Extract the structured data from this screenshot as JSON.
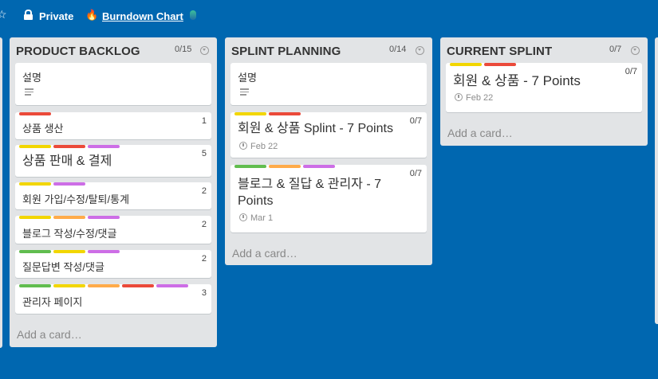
{
  "header": {
    "visibility": "Private",
    "burndown": "Burndown Chart",
    "icons": [
      "star-icon",
      "lock-icon",
      "flame-icon",
      "extension-icon"
    ]
  },
  "label_colors": {
    "red": "#eb4a3a",
    "yellow": "#f2d600",
    "purple": "#cd6ee6",
    "orange": "#ffab4a",
    "green": "#61bd4f"
  },
  "lists": [
    {
      "title": "PRODUCT BACKLOG",
      "count": "0/15",
      "cards": [
        {
          "title": "설명",
          "description_icon": true
        },
        {
          "title": "상품 생산",
          "count": "1",
          "labels": [
            "red"
          ]
        },
        {
          "title": "상품 판매 & 결제",
          "count": "5",
          "labels": [
            "yellow",
            "red",
            "purple"
          ]
        },
        {
          "title": "회원 가입/수정/탈퇴/통계",
          "count": "2",
          "labels": [
            "yellow",
            "purple"
          ]
        },
        {
          "title": "블로그 작성/수정/댓글",
          "count": "2",
          "labels": [
            "yellow",
            "orange",
            "purple"
          ]
        },
        {
          "title": "질문답변 작성/댓글",
          "count": "2",
          "labels": [
            "green",
            "yellow",
            "purple"
          ]
        },
        {
          "title": "관리자 페이지",
          "count": "3",
          "labels": [
            "green",
            "yellow",
            "orange",
            "red",
            "purple"
          ]
        }
      ],
      "add_card": "Add a card…"
    },
    {
      "title": "SPLINT PLANNING",
      "count": "0/14",
      "cards": [
        {
          "title": "설명",
          "description_icon": true
        },
        {
          "title": "회원 & 상품 Splint - 7 Points",
          "count": "0/7",
          "due": "Feb 22",
          "labels": [
            "yellow",
            "red"
          ]
        },
        {
          "title": "블로그 & 질답 & 관리자 - 7 Points",
          "count": "0/7",
          "due": "Mar 1",
          "labels": [
            "green",
            "orange",
            "purple"
          ]
        }
      ],
      "add_card": "Add a card…"
    },
    {
      "title": "CURRENT SPLINT",
      "count": "0/7",
      "cards": [
        {
          "title": "회원 & 상품 - 7 Points",
          "count": "0/7",
          "due": "Feb 22",
          "labels": [
            "yellow",
            "red"
          ]
        }
      ],
      "add_card": "Add a card…"
    }
  ]
}
